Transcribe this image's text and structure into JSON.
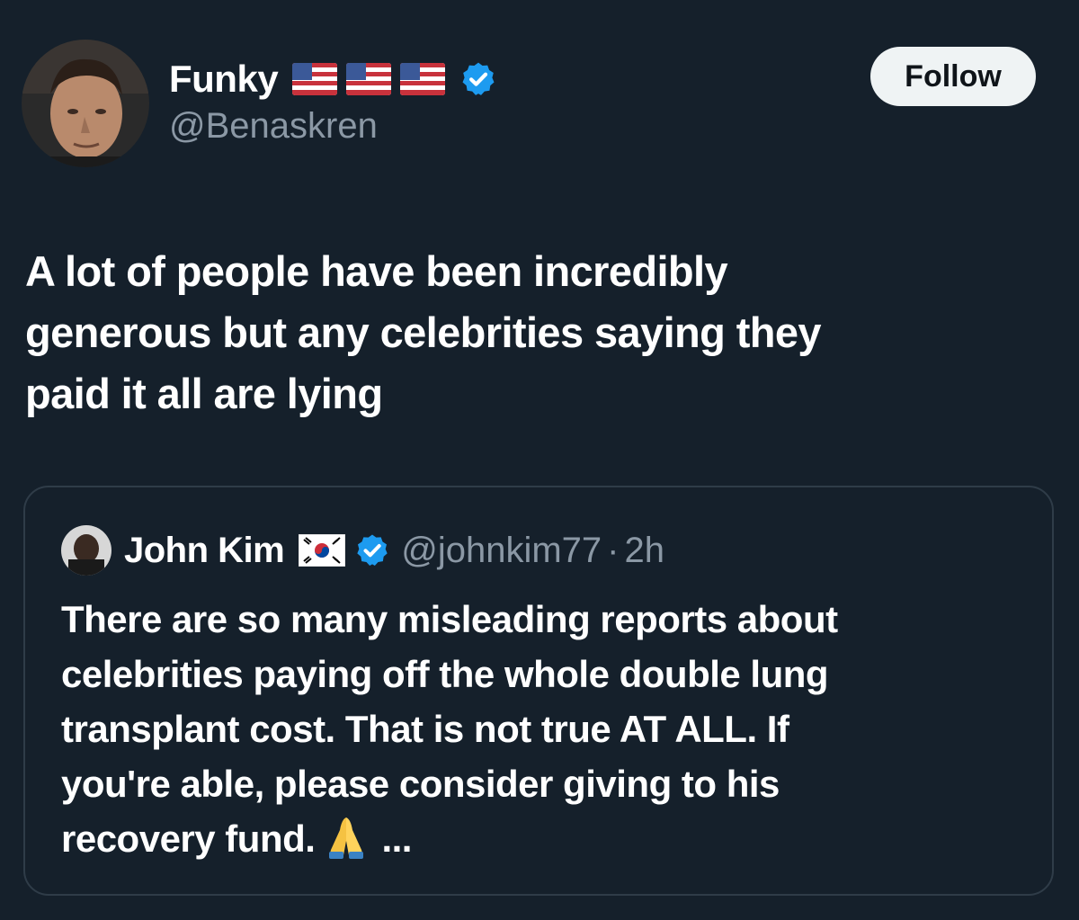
{
  "author": {
    "display_name": "Funky",
    "handle": "@Benaskren",
    "flags": [
      "us-flag-icon",
      "us-flag-icon",
      "us-flag-icon"
    ],
    "verified": true,
    "avatar": "profile-photo"
  },
  "follow_button": {
    "label": "Follow"
  },
  "tweet": {
    "lines": [
      "A lot of people have been incredibly",
      "generous but any celebrities saying they",
      "paid it all are lying"
    ]
  },
  "quoted_tweet": {
    "display_name": "John Kim",
    "flag": "south-korea-flag-icon",
    "verified": true,
    "handle": "@johnkim77",
    "separator": "·",
    "time": "2h",
    "lines": [
      "There are so many misleading reports about",
      "celebrities paying off the whole double lung",
      "transplant cost. That is not true AT ALL. If",
      "you're able, please consider giving to his",
      "recovery fund."
    ],
    "emoji": "folded-hands-icon",
    "ellipsis": "..."
  },
  "colors": {
    "background": "#15202b",
    "text_primary": "#ffffff",
    "text_secondary": "#8b98a5",
    "verified_blue": "#1d9bf0",
    "follow_bg": "#eff3f4",
    "card_border": "#2f3c48"
  }
}
